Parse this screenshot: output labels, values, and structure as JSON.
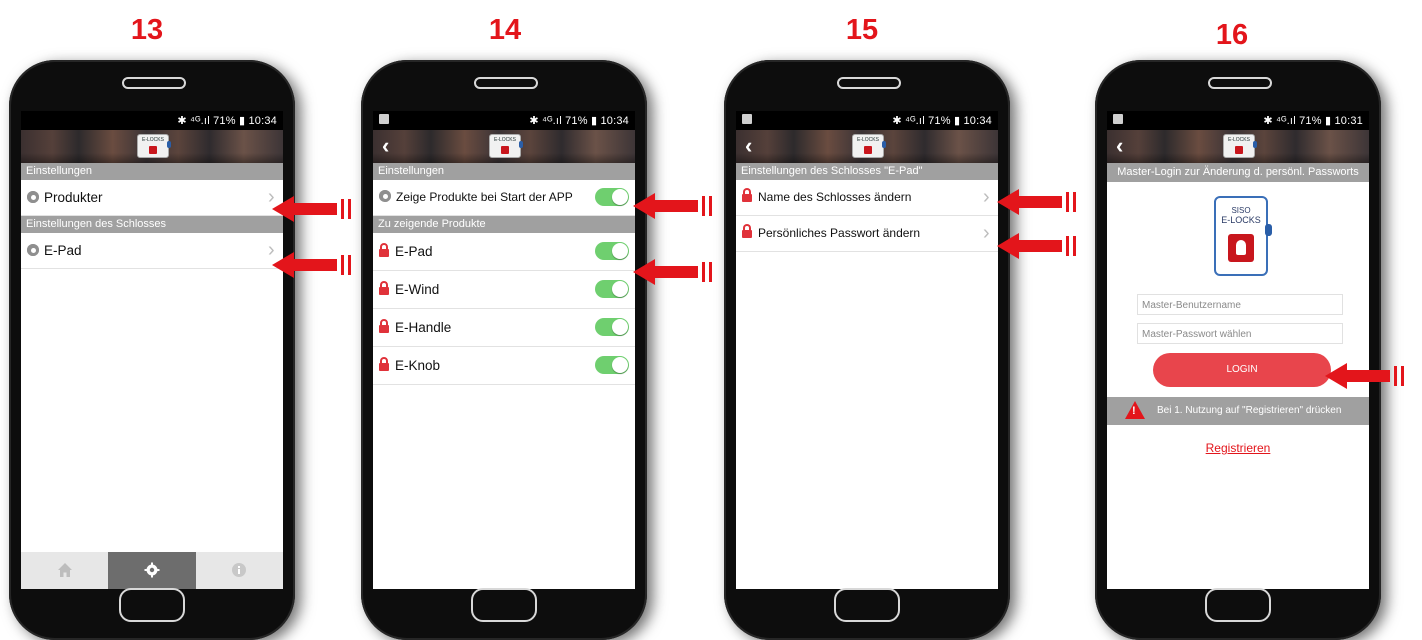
{
  "steps": [
    "13",
    "14",
    "15",
    "16"
  ],
  "status": {
    "screen13": "✱ ⁴ᴳ.ıl 71% ▮ 10:34",
    "screen14": "✱ ⁴ᴳ.ıl 71% ▮ 10:34",
    "screen15": "✱ ⁴ᴳ.ıl 71% ▮ 10:34",
    "screen16": "✱ ⁴ᴳ.ıl 71% ▮ 10:31"
  },
  "logo": {
    "line1": "SISO",
    "line2": "E-LOCKS"
  },
  "back_glyph": "‹",
  "screen13": {
    "section1": "Einstellungen",
    "item1": "Produkter",
    "section2": "Einstellungen des Schlosses",
    "item2": "E-Pad",
    "tabs": [
      "home-icon",
      "gear-icon",
      "info-icon"
    ]
  },
  "screen14": {
    "section1": "Einstellungen",
    "toggle_row": "Zeige Produkte bei Start der APP",
    "section2": "Zu zeigende Produkte",
    "products": [
      "E-Pad",
      "E-Wind",
      "E-Handle",
      "E-Knob"
    ],
    "toggles_on": [
      true,
      true,
      true,
      true,
      true
    ]
  },
  "screen15": {
    "section": "Einstellungen des Schlosses \"E-Pad\"",
    "item1": "Name des Schlosses ändern",
    "item2": "Persönliches Passwort ändern"
  },
  "screen16": {
    "title": "Master-Login zur Änderung d. persönl. Passworts",
    "username_placeholder": "Master-Benutzername",
    "password_placeholder": "Master-Passwort wählen",
    "login_label": "LOGIN",
    "warning": "Bei 1. Nutzung auf \"Registrieren\" drücken",
    "register_link": "Registrieren"
  },
  "colors": {
    "accent_red": "#e3151b",
    "toggle_green": "#6fcf6f",
    "section_gray": "#a0a0a0"
  }
}
